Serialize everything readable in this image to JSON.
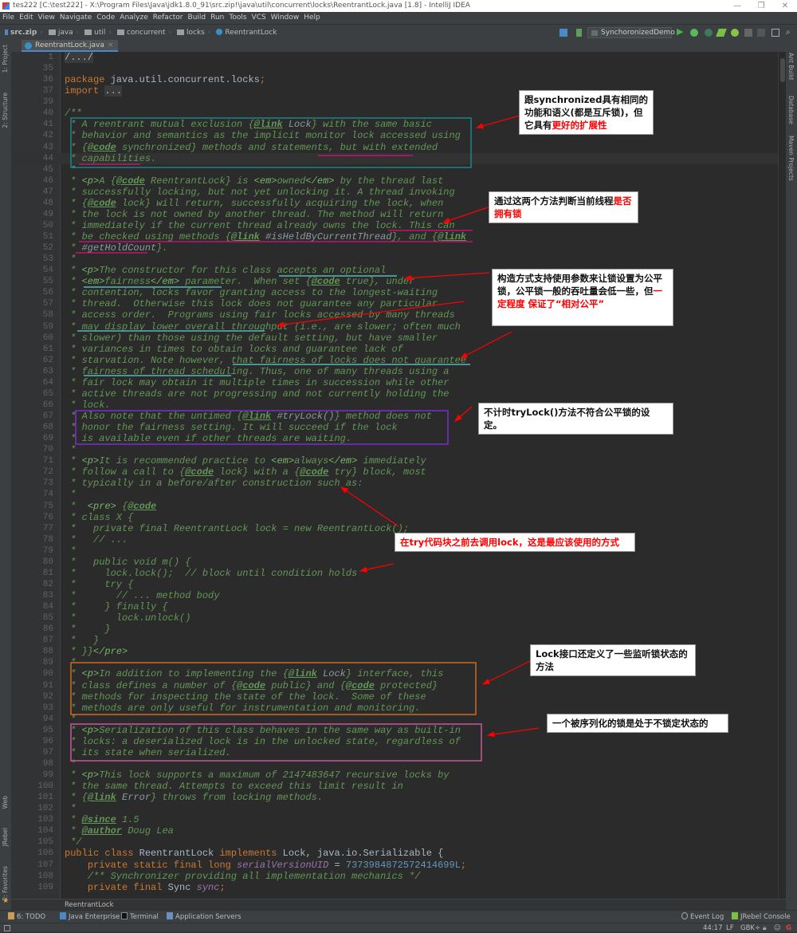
{
  "window": {
    "title": "tes222 [C:\\test222] - X:\\Program Files\\Java\\jdk1.8.0_91\\src.zip!\\java\\util\\concurrent\\locks\\ReentrantLock.java [1.8] - IntelliJ IDEA",
    "minimize": "—",
    "maximize": "❐",
    "close": "✕"
  },
  "menu": [
    "File",
    "Edit",
    "View",
    "Navigate",
    "Code",
    "Analyze",
    "Refactor",
    "Build",
    "Run",
    "Tools",
    "VCS",
    "Window",
    "Help"
  ],
  "breadcrumbs": [
    "src.zip",
    "java",
    "util",
    "concurrent",
    "locks",
    "ReentrantLock"
  ],
  "run_config": "SynchoronizedDemo",
  "tab": {
    "label": "ReentrantLock.java",
    "close": "×"
  },
  "left_tools": [
    "1: Project",
    "2: Structure",
    "Web",
    "JRebel",
    "2: Favorites"
  ],
  "right_tools": [
    "Ant Build",
    "Database",
    "Maven Projects"
  ],
  "caret_line": 44,
  "code": [
    {
      "n": "1",
      "s": [
        [
          "fold",
          "/.../"
        ]
      ]
    },
    {
      "n": "35",
      "s": []
    },
    {
      "n": "36",
      "s": [
        [
          "k",
          "package "
        ],
        [
          "d",
          "java.util.concurrent.locks"
        ],
        [
          "k",
          ";"
        ]
      ]
    },
    {
      "n": "37",
      "s": [
        [
          "k",
          "import "
        ],
        [
          "fold",
          "..."
        ]
      ]
    },
    {
      "n": "39",
      "s": []
    },
    {
      "n": "40",
      "s": [
        [
          "c",
          "/**"
        ]
      ]
    },
    {
      "n": "41",
      "s": [
        [
          "c",
          " * A reentrant mutual exclusion {"
        ],
        [
          "t",
          "@link"
        ],
        [
          "cr",
          " Lock"
        ],
        [
          "c",
          "} with the same basic"
        ]
      ]
    },
    {
      "n": "42",
      "s": [
        [
          "c",
          " * behavior and semantics as the implicit monitor lock accessed using"
        ]
      ]
    },
    {
      "n": "43",
      "s": [
        [
          "c",
          " * {"
        ],
        [
          "t",
          "@code"
        ],
        [
          "c",
          " synchronized} methods and statements, but with extended"
        ]
      ]
    },
    {
      "n": "44",
      "s": [
        [
          "c",
          " * capabilities."
        ]
      ]
    },
    {
      "n": "45",
      "s": [
        [
          "c",
          " *"
        ]
      ]
    },
    {
      "n": "46",
      "s": [
        [
          "c",
          " * "
        ],
        [
          "ch",
          "<p>"
        ],
        [
          "c",
          "A {"
        ],
        [
          "t",
          "@code"
        ],
        [
          "c",
          " ReentrantLock} is "
        ],
        [
          "ch",
          "<em>"
        ],
        [
          "c",
          "owned"
        ],
        [
          "ch",
          "</em>"
        ],
        [
          "c",
          " by the thread last"
        ]
      ]
    },
    {
      "n": "47",
      "s": [
        [
          "c",
          " * successfully locking, but not yet unlocking it. A thread invoking"
        ]
      ]
    },
    {
      "n": "48",
      "s": [
        [
          "c",
          " * {"
        ],
        [
          "t",
          "@code"
        ],
        [
          "c",
          " lock} will return, successfully acquiring the lock, when"
        ]
      ]
    },
    {
      "n": "49",
      "s": [
        [
          "c",
          " * the lock is not owned by another thread. The method will return"
        ]
      ]
    },
    {
      "n": "50",
      "s": [
        [
          "c",
          " * immediately if the current thread already owns the lock. This can"
        ]
      ]
    },
    {
      "n": "51",
      "s": [
        [
          "c",
          " * be checked using methods {"
        ],
        [
          "t",
          "@link"
        ],
        [
          "cr",
          " #isHeldByCurrentThread"
        ],
        [
          "c",
          "}, and {"
        ],
        [
          "t",
          "@link"
        ]
      ]
    },
    {
      "n": "52",
      "s": [
        [
          "c",
          " * "
        ],
        [
          "cr",
          "#getHoldCount"
        ],
        [
          "c",
          "}."
        ]
      ]
    },
    {
      "n": "53",
      "s": [
        [
          "c",
          " *"
        ]
      ]
    },
    {
      "n": "54",
      "s": [
        [
          "c",
          " * "
        ],
        [
          "ch",
          "<p>"
        ],
        [
          "c",
          "The constructor for this class accepts an optional"
        ]
      ]
    },
    {
      "n": "55",
      "s": [
        [
          "c",
          " * "
        ],
        [
          "ch",
          "<em>"
        ],
        [
          "c",
          "fairness"
        ],
        [
          "ch",
          "</em>"
        ],
        [
          "c",
          " parameter.  When set {"
        ],
        [
          "t",
          "@code"
        ],
        [
          "c",
          " true}, under"
        ]
      ]
    },
    {
      "n": "56",
      "s": [
        [
          "c",
          " * contention, locks favor granting access to the longest-waiting"
        ]
      ]
    },
    {
      "n": "57",
      "s": [
        [
          "c",
          " * thread.  Otherwise this lock does not guarantee any particular"
        ]
      ]
    },
    {
      "n": "58",
      "s": [
        [
          "c",
          " * access order.  Programs using fair locks accessed by many threads"
        ]
      ]
    },
    {
      "n": "59",
      "s": [
        [
          "c",
          " * may display lower overall throughput (i.e., are slower; often much"
        ]
      ]
    },
    {
      "n": "60",
      "s": [
        [
          "c",
          " * slower) than those using the default setting, but have smaller"
        ]
      ]
    },
    {
      "n": "61",
      "s": [
        [
          "c",
          " * variances in times to obtain locks and guarantee lack of"
        ]
      ]
    },
    {
      "n": "62",
      "s": [
        [
          "c",
          " * starvation. Note however, that fairness of locks does not guarantee"
        ]
      ]
    },
    {
      "n": "63",
      "s": [
        [
          "c",
          " * fairness of thread scheduling. Thus, one of many threads using a"
        ]
      ]
    },
    {
      "n": "64",
      "s": [
        [
          "c",
          " * fair lock may obtain it multiple times in succession while other"
        ]
      ]
    },
    {
      "n": "65",
      "s": [
        [
          "c",
          " * active threads are not progressing and not currently holding the"
        ]
      ]
    },
    {
      "n": "66",
      "s": [
        [
          "c",
          " * lock."
        ]
      ]
    },
    {
      "n": "67",
      "s": [
        [
          "c",
          " * Also note that the untimed {"
        ],
        [
          "t",
          "@link"
        ],
        [
          "cr",
          " #tryLock()"
        ],
        [
          "c",
          "} method does not"
        ]
      ]
    },
    {
      "n": "68",
      "s": [
        [
          "c",
          " * honor the fairness setting. It will succeed if the lock"
        ]
      ]
    },
    {
      "n": "69",
      "s": [
        [
          "c",
          " * is available even if other threads are waiting."
        ]
      ]
    },
    {
      "n": "70",
      "s": [
        [
          "c",
          " *"
        ]
      ]
    },
    {
      "n": "71",
      "s": [
        [
          "c",
          " * "
        ],
        [
          "ch",
          "<p>"
        ],
        [
          "c",
          "It is recommended practice to "
        ],
        [
          "ch",
          "<em>"
        ],
        [
          "c",
          "always"
        ],
        [
          "ch",
          "</em>"
        ],
        [
          "c",
          " immediately"
        ]
      ]
    },
    {
      "n": "72",
      "s": [
        [
          "c",
          " * follow a call to {"
        ],
        [
          "t",
          "@code"
        ],
        [
          "c",
          " lock} with a {"
        ],
        [
          "t",
          "@code"
        ],
        [
          "c",
          " try} block, most"
        ]
      ]
    },
    {
      "n": "73",
      "s": [
        [
          "c",
          " * typically in a before/after construction such as:"
        ]
      ]
    },
    {
      "n": "74",
      "s": [
        [
          "c",
          " *"
        ]
      ]
    },
    {
      "n": "75",
      "s": [
        [
          "c",
          " *  "
        ],
        [
          "ch",
          "<pre>"
        ],
        [
          "c",
          " {"
        ],
        [
          "t",
          "@code"
        ]
      ]
    },
    {
      "n": "76",
      "s": [
        [
          "c",
          " * class X {"
        ]
      ]
    },
    {
      "n": "77",
      "s": [
        [
          "c",
          " *   private final ReentrantLock lock = new ReentrantLock();"
        ]
      ]
    },
    {
      "n": "78",
      "s": [
        [
          "c",
          " *   // ..."
        ]
      ]
    },
    {
      "n": "79",
      "s": [
        [
          "c",
          " *"
        ]
      ]
    },
    {
      "n": "80",
      "s": [
        [
          "c",
          " *   public void m() {"
        ]
      ]
    },
    {
      "n": "81",
      "s": [
        [
          "c",
          " *     lock.lock();  // block until condition holds"
        ]
      ]
    },
    {
      "n": "82",
      "s": [
        [
          "c",
          " *     try {"
        ]
      ]
    },
    {
      "n": "83",
      "s": [
        [
          "c",
          " *       // ... method body"
        ]
      ]
    },
    {
      "n": "84",
      "s": [
        [
          "c",
          " *     } finally {"
        ]
      ]
    },
    {
      "n": "85",
      "s": [
        [
          "c",
          " *       lock.unlock()"
        ]
      ]
    },
    {
      "n": "86",
      "s": [
        [
          "c",
          " *     }"
        ]
      ]
    },
    {
      "n": "87",
      "s": [
        [
          "c",
          " *   }"
        ]
      ]
    },
    {
      "n": "88",
      "s": [
        [
          "c",
          " * }}"
        ],
        [
          "ch",
          "</pre>"
        ]
      ]
    },
    {
      "n": "89",
      "s": [
        [
          "c",
          " *"
        ]
      ]
    },
    {
      "n": "90",
      "s": [
        [
          "c",
          " * "
        ],
        [
          "ch",
          "<p>"
        ],
        [
          "c",
          "In addition to implementing the {"
        ],
        [
          "t",
          "@link"
        ],
        [
          "cr",
          " Lock"
        ],
        [
          "c",
          "} interface, this"
        ]
      ]
    },
    {
      "n": "91",
      "s": [
        [
          "c",
          " * class defines a number of {"
        ],
        [
          "t",
          "@code"
        ],
        [
          "c",
          " public} and {"
        ],
        [
          "t",
          "@code"
        ],
        [
          "c",
          " protected}"
        ]
      ]
    },
    {
      "n": "92",
      "s": [
        [
          "c",
          " * methods for inspecting the state of the lock.  Some of these"
        ]
      ]
    },
    {
      "n": "93",
      "s": [
        [
          "c",
          " * methods are only useful for instrumentation and monitoring."
        ]
      ]
    },
    {
      "n": "94",
      "s": [
        [
          "c",
          " *"
        ]
      ]
    },
    {
      "n": "95",
      "s": [
        [
          "c",
          " * "
        ],
        [
          "ch",
          "<p>"
        ],
        [
          "c",
          "Serialization of this class behaves in the same way as built-in"
        ]
      ]
    },
    {
      "n": "96",
      "s": [
        [
          "c",
          " * locks: a deserialized lock is in the unlocked state, regardless of"
        ]
      ]
    },
    {
      "n": "97",
      "s": [
        [
          "c",
          " * its state when serialized."
        ]
      ]
    },
    {
      "n": "98",
      "s": [
        [
          "c",
          " *"
        ]
      ]
    },
    {
      "n": "99",
      "s": [
        [
          "c",
          " * "
        ],
        [
          "ch",
          "<p>"
        ],
        [
          "c",
          "This lock supports a maximum of 2147483647 recursive locks by"
        ]
      ]
    },
    {
      "n": "100",
      "s": [
        [
          "c",
          " * the same thread. Attempts to exceed this limit result in"
        ]
      ]
    },
    {
      "n": "101",
      "s": [
        [
          "c",
          " * {"
        ],
        [
          "t",
          "@link"
        ],
        [
          "cr",
          " Error"
        ],
        [
          "c",
          "} throws from locking methods."
        ]
      ]
    },
    {
      "n": "102",
      "s": [
        [
          "c",
          " *"
        ]
      ]
    },
    {
      "n": "103",
      "s": [
        [
          "c",
          " * "
        ],
        [
          "t",
          "@since"
        ],
        [
          "c",
          " 1.5"
        ]
      ]
    },
    {
      "n": "104",
      "s": [
        [
          "c",
          " * "
        ],
        [
          "t",
          "@author"
        ],
        [
          "c",
          " Doug Lea"
        ]
      ]
    },
    {
      "n": "105",
      "s": [
        [
          "c",
          " */"
        ]
      ]
    },
    {
      "n": "106",
      "s": [
        [
          "k",
          "public class "
        ],
        [
          "d",
          "ReentrantLock "
        ],
        [
          "k",
          "implements "
        ],
        [
          "d",
          "Lock, java.io.Serializable {"
        ]
      ]
    },
    {
      "n": "107",
      "s": [
        [
          "d",
          "    "
        ],
        [
          "k",
          "private static final long "
        ],
        [
          "f",
          "serialVersionUID"
        ],
        [
          "d",
          " = "
        ],
        [
          "n",
          "7373984872572414699L"
        ],
        [
          "k",
          ";"
        ]
      ]
    },
    {
      "n": "108",
      "s": [
        [
          "c",
          "    /** Synchronizer providing all implementation mechanics */"
        ]
      ]
    },
    {
      "n": "109",
      "s": [
        [
          "d",
          "    "
        ],
        [
          "k",
          "private final "
        ],
        [
          "d",
          "Sync "
        ],
        [
          "f",
          "sync"
        ],
        [
          "k",
          ";"
        ]
      ]
    }
  ],
  "callouts": [
    {
      "parts": [
        [
          "跟synchronized具有相同的功能和语义(都是互斥锁)，但它具有",
          false
        ],
        [
          "更好的扩展性",
          true
        ]
      ]
    },
    {
      "parts": [
        [
          "通过这两个方法判断当前线程",
          false
        ],
        [
          "是否拥有锁",
          true
        ]
      ]
    },
    {
      "parts": [
        [
          "构造方式支持使用参数来让锁设置为公平锁，公平锁一般的吞吐量会低一些，但",
          false
        ],
        [
          "一定程度 保证了“相对公平”",
          true
        ]
      ]
    },
    {
      "parts": [
        [
          "不计时tryLock()方法不符合公平锁的设定。",
          false
        ]
      ]
    },
    {
      "parts": [
        [
          "在try代码块之前去调用lock，这是最应该使用的方式",
          true
        ]
      ]
    },
    {
      "parts": [
        [
          "Lock接口还定义了一些监听锁状态的方法",
          false
        ]
      ]
    },
    {
      "parts": [
        [
          "一个被序列化的锁是处于不锁定状态的",
          false
        ]
      ]
    }
  ],
  "footer_breadcrumb": "ReentrantLock",
  "tool_windows": [
    "6: TODO",
    "Java Enterprise",
    "Terminal",
    "Application Servers"
  ],
  "tool_windows_right": [
    "Event Log",
    "JRebel Console"
  ],
  "status": {
    "position": "44:17",
    "line_sep": "LF",
    "encoding": "GBK÷"
  },
  "colors": {
    "accent_red": "#ff0000",
    "teal_box": "#1a9a9a",
    "purple_box": "#7b2fd0",
    "orange_box": "#d06a20",
    "pink_box": "#c85aa0",
    "magenta_underline": "#e0107a",
    "cyan_underline": "#5fd3d3"
  }
}
